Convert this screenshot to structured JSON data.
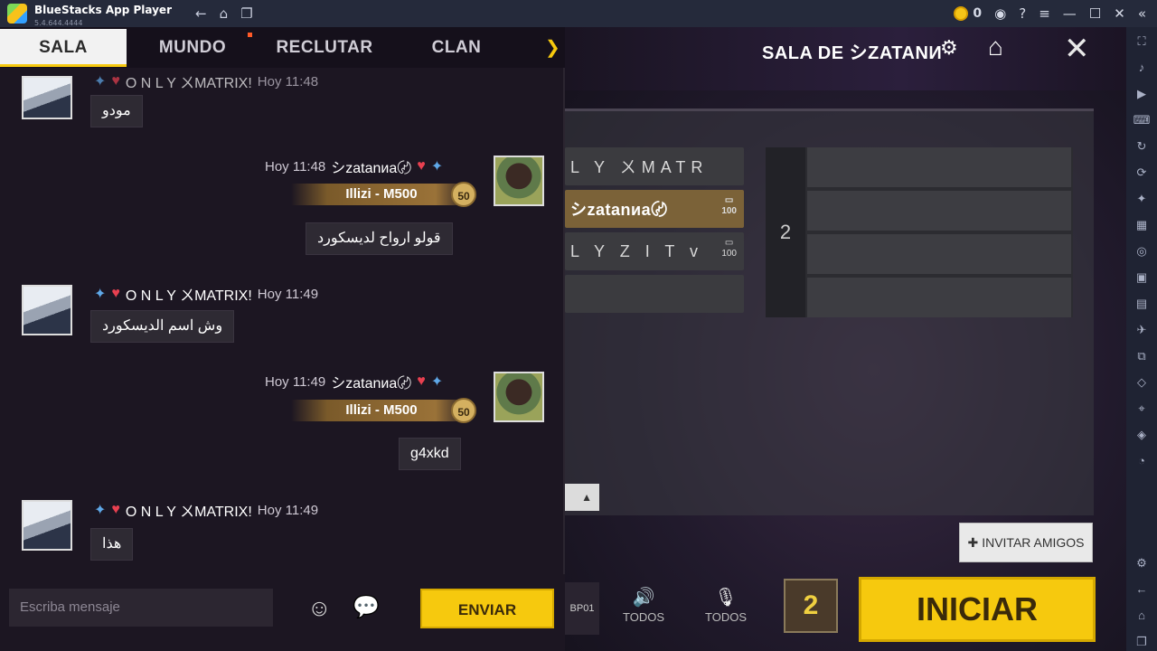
{
  "titlebar": {
    "app_name": "BlueStacks App Player",
    "version": "5.4.644.4444",
    "coin_count": "0",
    "icons": [
      "back-icon",
      "home-icon",
      "recent-apps-icon",
      "account-icon",
      "help-icon",
      "menu-icon",
      "minimize-icon",
      "maximize-icon",
      "close-icon",
      "collapse-icon"
    ]
  },
  "chat": {
    "tabs": [
      {
        "label": "SALA"
      },
      {
        "label": "MUNDO"
      },
      {
        "label": "RECLUTAR"
      },
      {
        "label": "CLAN"
      }
    ],
    "messages": [
      {
        "user": "O N L Y ㄨMATRIX!",
        "time": "Hoy 11:48",
        "text": "مودو",
        "side": "left"
      },
      {
        "user": "シzatanиa〄",
        "time": "Hoy 11:48",
        "guild": "Illizi - M500",
        "level": "50",
        "text": "قولو ارواح لديسكورد",
        "side": "right"
      },
      {
        "user": "O N L Y ㄨMATRIX!",
        "time": "Hoy 11:49",
        "text": "وش اسم الديسكورد",
        "side": "left"
      },
      {
        "user": "シzatanиa〄",
        "time": "Hoy 11:49",
        "guild": "Illizi - M500",
        "level": "50",
        "text": "g4xkd",
        "side": "right"
      },
      {
        "user": "O N L Y ㄨMATRIX!",
        "time": "Hoy 11:49",
        "text": "هذا",
        "side": "left"
      }
    ],
    "input_placeholder": "Escriba mensaje",
    "send_label": "ENVIAR"
  },
  "room": {
    "title": "SALA DE シZATANИ",
    "team1": [
      {
        "name": "L Y ㄨMATR"
      },
      {
        "name": "シzatanиa〄",
        "device": "100"
      },
      {
        "name": "L Y Z I T v",
        "device": "100"
      },
      {
        "name": ""
      }
    ],
    "team2_number": "2",
    "invite_label": "INVITAR AMIGOS",
    "bp_label": "BP01",
    "audio": [
      {
        "label": "TODOS"
      },
      {
        "label": "TODOS"
      }
    ],
    "crate_number": "2",
    "start_label": "INICIAR"
  }
}
